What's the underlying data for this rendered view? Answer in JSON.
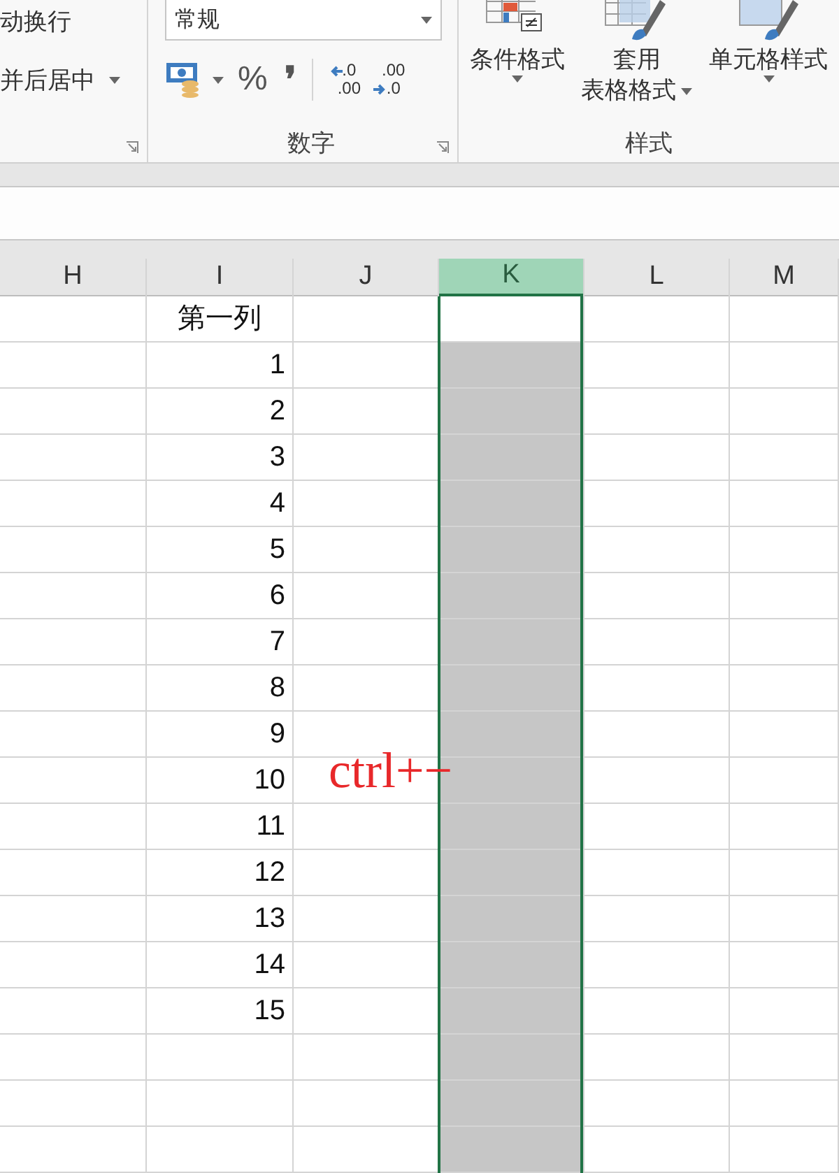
{
  "ribbon": {
    "groups": [
      {
        "kind": "alignment",
        "items": [
          {
            "label": "动换行",
            "dropdown": false
          },
          {
            "label": "并后居中",
            "dropdown": true
          }
        ]
      },
      {
        "kind": "number",
        "label": "数字",
        "format": "常规",
        "percent": "%",
        "comma": "❜",
        "inc_decimal": [
          ".0",
          ".00"
        ],
        "dec_decimal": [
          ".00",
          ".0"
        ]
      },
      {
        "kind": "styles",
        "label": "样式",
        "items": [
          {
            "lines": [
              "条件格式"
            ]
          },
          {
            "lines": [
              "套用",
              "表格格式"
            ]
          },
          {
            "lines": [
              "单元格样式"
            ]
          }
        ]
      }
    ]
  },
  "sheet": {
    "columns": [
      {
        "label": "H",
        "selected": false
      },
      {
        "label": "I",
        "selected": false,
        "cells": [
          "第一列",
          "1",
          "2",
          "3",
          "4",
          "5",
          "6",
          "7",
          "8",
          "9",
          "10",
          "11",
          "12",
          "13",
          "14",
          "15"
        ]
      },
      {
        "label": "J",
        "selected": false
      },
      {
        "label": "K",
        "selected": true,
        "active_top_cell": true
      },
      {
        "label": "L",
        "selected": false
      },
      {
        "label": "M",
        "selected": false
      }
    ]
  },
  "annotation": {
    "text": "ctrl+−"
  }
}
